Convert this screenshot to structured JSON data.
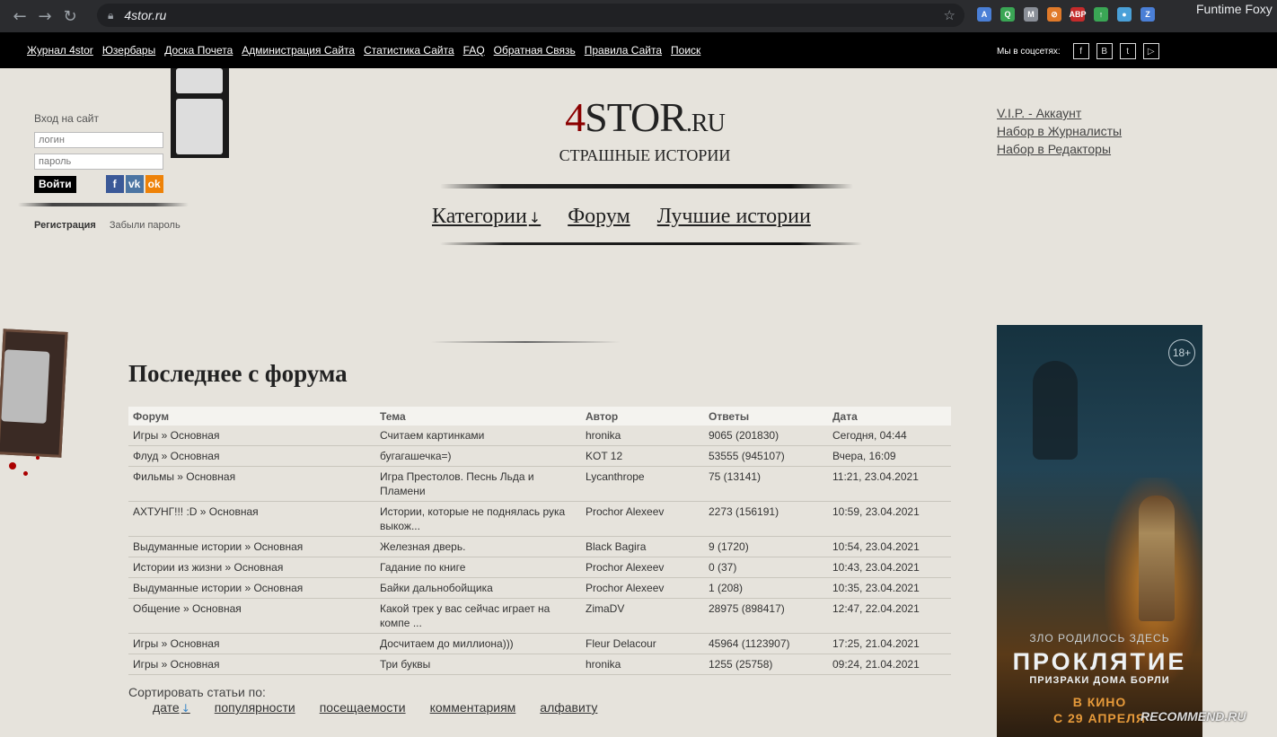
{
  "browser": {
    "url": "4stor.ru",
    "profile_name": "Funtime Foxy",
    "extensions": [
      {
        "name": "translate-icon",
        "label": "A",
        "color": "#4a7fd6"
      },
      {
        "name": "q-extension-icon",
        "label": "Q",
        "color": "#3aa655"
      },
      {
        "name": "m-extension-icon",
        "label": "M",
        "color": "#8a8f98"
      },
      {
        "name": "orange-extension-icon",
        "label": "⊘",
        "color": "#e07a2a"
      },
      {
        "name": "adblock-icon",
        "label": "ABP",
        "color": "#c42b2b"
      },
      {
        "name": "green-extension-icon",
        "label": "↑",
        "color": "#3aa655"
      },
      {
        "name": "drop-extension-icon",
        "label": "●",
        "color": "#4aa0d8"
      },
      {
        "name": "z-extension-icon",
        "label": "Z",
        "color": "#4a7fd6"
      }
    ]
  },
  "topmenu": {
    "items": [
      "Журнал 4stor",
      "Юзербары",
      "Доска Почета",
      "Администрация Сайта",
      "Статистика Сайта",
      "FAQ",
      "Обратная Связь",
      "Правила Сайта",
      "Поиск"
    ],
    "social_label": "Мы в соцсетях:",
    "social_icons": [
      "facebook-icon",
      "vk-icon",
      "twitter-icon",
      "youtube-icon"
    ]
  },
  "login": {
    "title": "Вход на сайт",
    "login_placeholder": "логин",
    "password_placeholder": "пароль",
    "submit": "Войти",
    "register": "Регистрация",
    "forgot": "Забыли пароль",
    "socials": [
      {
        "name": "facebook-login-icon",
        "label": "f",
        "color": "#3b5998"
      },
      {
        "name": "vk-login-icon",
        "label": "vk",
        "color": "#4c75a3"
      },
      {
        "name": "odnoklassniki-login-icon",
        "label": "ok",
        "color": "#ee8208"
      }
    ]
  },
  "logo": {
    "four": "4",
    "name": "STOR",
    "domain": ".RU",
    "tagline": "СТРАШНЫЕ ИСТОРИИ"
  },
  "mainnav": {
    "categories": "Категории",
    "forum": "Форум",
    "best": "Лучшие истории"
  },
  "rightlinks": [
    "V.I.P. - Аккаунт",
    "Набор в Журналисты",
    "Набор в Редакторы"
  ],
  "forum": {
    "title": "Последнее с форума",
    "headers": [
      "Форум",
      "Тема",
      "Автор",
      "Ответы",
      "Дата"
    ],
    "rows": [
      [
        "Игры » Основная",
        "Считаем картинками",
        "hronika",
        "9065 (201830)",
        "Сегодня, 04:44"
      ],
      [
        "Флуд » Основная",
        "бугагашечка=)",
        "KOT 12",
        "53555 (945107)",
        "Вчера, 16:09"
      ],
      [
        "Фильмы » Основная",
        "Игра Престолов. Песнь Льда и Пламени",
        "Lycanthrope",
        "75 (13141)",
        "11:21, 23.04.2021"
      ],
      [
        "АХТУНГ!!! :D » Основная",
        "Истории, которые не поднялась рука выкож...",
        "Prochor Alexeev",
        "2273 (156191)",
        "10:59, 23.04.2021"
      ],
      [
        "Выдуманные истории » Основная",
        "Железная дверь.",
        "Black Bagira",
        "9 (1720)",
        "10:54, 23.04.2021"
      ],
      [
        "Истории из жизни » Основная",
        "Гадание по книге",
        "Prochor Alexeev",
        "0 (37)",
        "10:43, 23.04.2021"
      ],
      [
        "Выдуманные истории » Основная",
        "Байки дальнобойщика",
        "Prochor Alexeev",
        "1 (208)",
        "10:35, 23.04.2021"
      ],
      [
        "Общение » Основная",
        "Какой трек у вас сейчас играет на компе ...",
        "ZimaDV",
        "28975 (898417)",
        "12:47, 22.04.2021"
      ],
      [
        "Игры » Основная",
        "Досчитаем до миллиона)))",
        "Fleur Delacour",
        "45964 (1123907)",
        "17:25, 21.04.2021"
      ],
      [
        "Игры » Основная",
        "Три буквы",
        "hronika",
        "1255 (25758)",
        "09:24, 21.04.2021"
      ]
    ]
  },
  "sort": {
    "label": "Сортировать статьи по:",
    "options": [
      "дате",
      "популярности",
      "посещаемости",
      "комментариям",
      "алфавиту"
    ]
  },
  "ad": {
    "age": "18+",
    "tagline": "ЗЛО РОДИЛОСЬ ЗДЕСЬ",
    "title": "ПРОКЛЯТИЕ",
    "subtitle": "ПРИЗРАКИ ДОМА БОРЛИ",
    "kino": "В КИНО",
    "date": "С 29 АПРЕЛЯ"
  },
  "watermark": "RECOMMEND.RU"
}
